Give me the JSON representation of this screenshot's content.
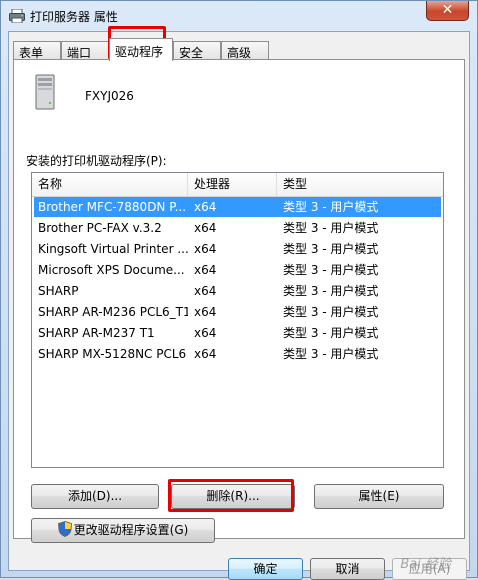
{
  "window": {
    "title": "打印服务器 属性",
    "close_label": "✕"
  },
  "tabs": [
    {
      "label": "表单"
    },
    {
      "label": "端口"
    },
    {
      "label": "驱动程序"
    },
    {
      "label": "安全"
    },
    {
      "label": "高级"
    }
  ],
  "active_tab": "驱动程序",
  "server": {
    "name": "FXYJ026",
    "icon": "server-computer-icon"
  },
  "drivers": {
    "label": "安装的打印机驱动程序(P):",
    "columns": [
      "名称",
      "处理器",
      "类型"
    ],
    "rows": [
      {
        "name": "Brother MFC-7880DN P...",
        "processor": "x64",
        "type": "类型 3 - 用户模式",
        "selected": true
      },
      {
        "name": "Brother PC-FAX v.3.2",
        "processor": "x64",
        "type": "类型 3 - 用户模式"
      },
      {
        "name": "Kingsoft Virtual Printer ...",
        "processor": "x64",
        "type": "类型 3 - 用户模式"
      },
      {
        "name": "Microsoft XPS Docume...",
        "processor": "x64",
        "type": "类型 3 - 用户模式"
      },
      {
        "name": "SHARP",
        "processor": "x64",
        "type": "类型 3 - 用户模式"
      },
      {
        "name": "SHARP AR-M236 PCL6_T1",
        "processor": "x64",
        "type": "类型 3 - 用户模式"
      },
      {
        "name": "SHARP AR-M237 T1",
        "processor": "x64",
        "type": "类型 3 - 用户模式"
      },
      {
        "name": "SHARP MX-5128NC PCL6",
        "processor": "x64",
        "type": "类型 3 - 用户模式"
      }
    ]
  },
  "buttons": {
    "add": "添加(D)...",
    "remove": "删除(R)...",
    "properties": "属性(E)",
    "change_settings": "更改驱动程序设置(G)",
    "ok": "确定",
    "cancel": "取消",
    "apply": "应用(A)"
  },
  "watermark": "Bai 经验",
  "colors": {
    "selection": "#3399ff",
    "highlight_box": "#e60000"
  }
}
